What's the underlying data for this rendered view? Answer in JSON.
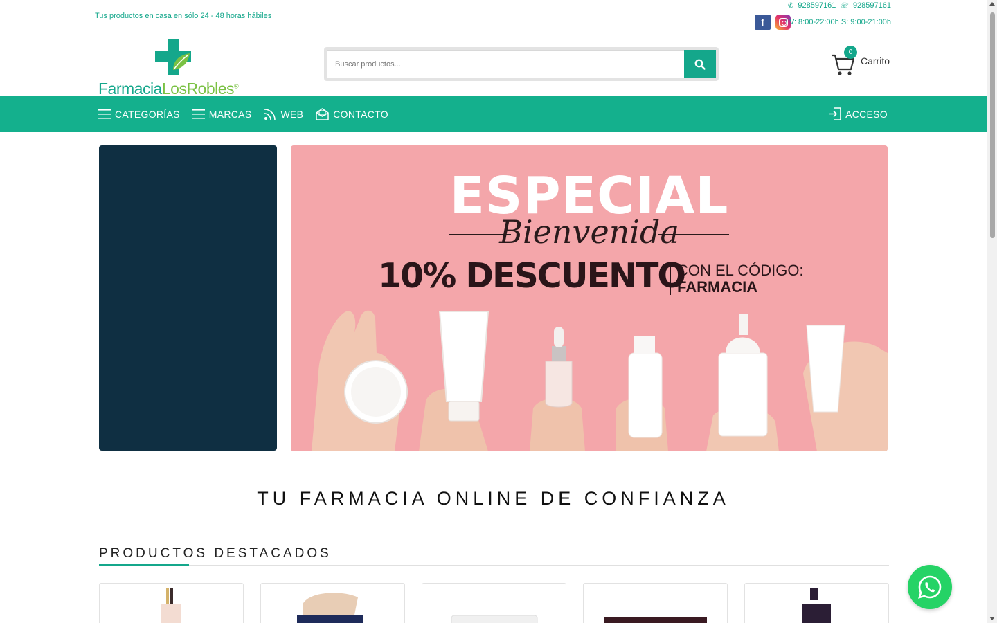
{
  "topbar": {
    "tagline": "Tus productos en casa en sólo 24 - 48 horas hábiles",
    "phone": "928597161",
    "whatsapp_phone": "928597161",
    "hours": "LV: 8:00-22:00h S: 9:00-21:00h",
    "facebook_letter": "f"
  },
  "logo": {
    "part1": "Farmacia",
    "part2": "LosRobles",
    "reg": "®"
  },
  "search": {
    "placeholder": "Buscar productos..."
  },
  "cart": {
    "count": "0",
    "label": "Carrito"
  },
  "nav": {
    "items": [
      {
        "label": "CATEGORÍAS",
        "icon": "menu-icon"
      },
      {
        "label": "MARCAS",
        "icon": "menu-icon"
      },
      {
        "label": "WEB",
        "icon": "rss-icon"
      },
      {
        "label": "CONTACTO",
        "icon": "envelope-icon"
      }
    ],
    "login": "ACCESO"
  },
  "banner": {
    "title": "ESPECIAL",
    "script": "Bienvenida",
    "discount": "10% DESCUENTO",
    "code_label": "CON EL CÓDIGO:",
    "code": "FARMACIA"
  },
  "tagline": "TU FARMACIA ONLINE DE CONFIANZA",
  "featured_title": "PRODUCTOS DESTACADOS",
  "colors": {
    "brand_green": "#14a78b",
    "nav_green": "#14b08d",
    "lime": "#7ac143",
    "navy_panel": "#0f2f42",
    "banner_pink": "#f4a6aa",
    "whatsapp": "#25d366"
  }
}
